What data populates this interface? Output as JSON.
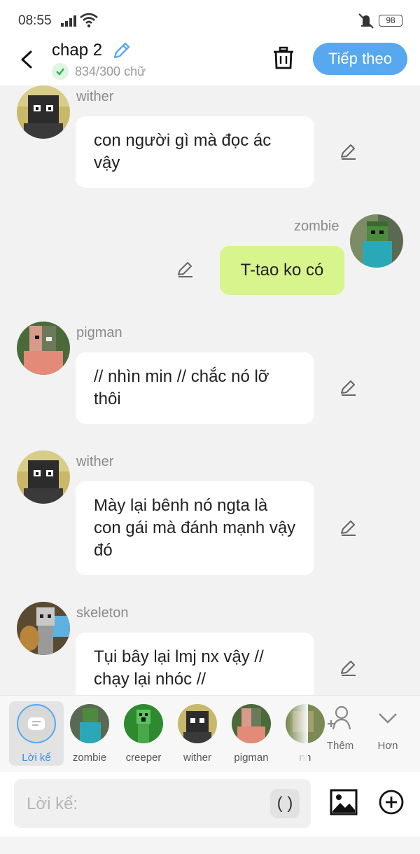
{
  "status": {
    "time": "08:55",
    "battery": "98"
  },
  "header": {
    "title": "chap 2",
    "word_count": "834/300 chữ",
    "next_label": "Tiếp theo"
  },
  "messages": [
    {
      "sender": "wither",
      "text": "con người gì mà đọc ác vậy",
      "side": "left"
    },
    {
      "sender": "zombie",
      "text": "T-tao ko có",
      "side": "right"
    },
    {
      "sender": "pigman",
      "text": "// nhìn min // chắc nó lỡ thôi",
      "side": "left"
    },
    {
      "sender": "wither",
      "text": "Mày lại bênh nó ngta là con gái mà đánh mạnh vậy đó",
      "side": "left"
    },
    {
      "sender": "skeleton",
      "text": "Tụi bây lại lmj nx vậy // chạy lại nhóc //",
      "side": "left"
    }
  ],
  "characters": [
    {
      "label": "Lời kể",
      "selected": true
    },
    {
      "label": "zombie"
    },
    {
      "label": "creeper"
    },
    {
      "label": "wither"
    },
    {
      "label": "pigman"
    },
    {
      "label": "nh"
    }
  ],
  "tools": {
    "add_label": "Thêm",
    "more_label": "Hơn"
  },
  "input": {
    "placeholder": "Lời kể:",
    "paren_label": "( )"
  },
  "colors": {
    "accent": "#58a8f0",
    "right_bubble": "#d7f48d",
    "background": "#f2f2f2"
  }
}
